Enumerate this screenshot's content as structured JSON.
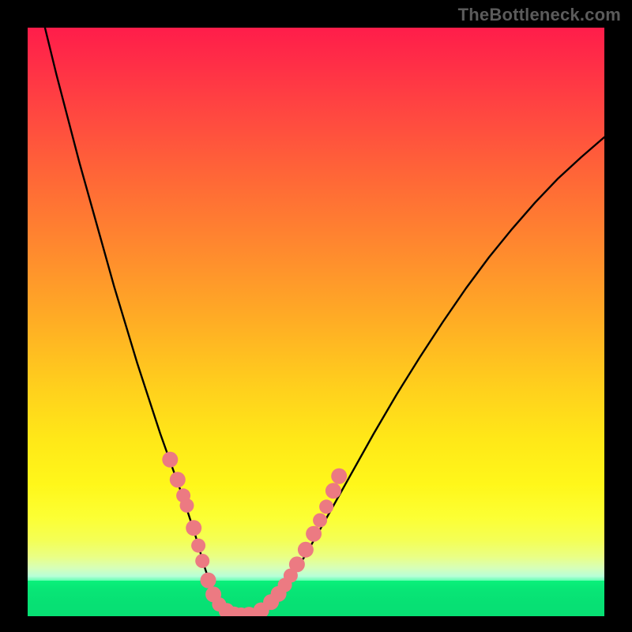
{
  "watermark": "TheBottleneck.com",
  "colors": {
    "frame": "#000000",
    "watermark_text": "#5b5b5b",
    "curve": "#000000",
    "dot": "#ec7a82",
    "gradient_top": "#ff1d4a",
    "gradient_bottom": "#07df73"
  },
  "chart_data": {
    "type": "line",
    "title": "",
    "xlabel": "",
    "ylabel": "",
    "xlim": [
      0,
      100
    ],
    "ylim": [
      0,
      100
    ],
    "grid": false,
    "legend": false,
    "annotations": [
      {
        "text": "TheBottleneck.com",
        "position": "top-right"
      }
    ],
    "series": [
      {
        "name": "bottleneck-curve",
        "type": "line",
        "x": [
          3,
          5,
          7,
          9,
          11,
          13,
          15,
          17,
          19,
          21,
          23,
          25,
          27,
          29,
          30.7,
          32.1,
          34,
          36,
          38,
          40,
          44,
          48,
          52,
          56,
          60,
          64,
          68,
          72,
          76,
          80,
          84,
          88,
          92,
          96,
          100
        ],
        "y": [
          100,
          92,
          84.5,
          77,
          70,
          63,
          56,
          49.5,
          43,
          37,
          31,
          25.5,
          20,
          14,
          8.3,
          4.2,
          1.6,
          0.4,
          0.1,
          0.7,
          4.3,
          10.1,
          17,
          24,
          31,
          37.7,
          44,
          50,
          55.7,
          61,
          65.8,
          70.3,
          74.4,
          78,
          81.4
        ]
      },
      {
        "name": "highlight-dots",
        "type": "scatter",
        "x": [
          24.7,
          26.0,
          27.0,
          27.6,
          28.8,
          29.6,
          30.3,
          31.3,
          32.2,
          33.2,
          34.5,
          35.8,
          37.0,
          38.4,
          40.5,
          42.2,
          43.5,
          44.6,
          45.6,
          46.7,
          48.2,
          49.6,
          50.7,
          51.8,
          53.0,
          54.0
        ],
        "y": [
          26.6,
          23.2,
          20.5,
          18.8,
          15.0,
          12.0,
          9.4,
          6.1,
          3.7,
          2.0,
          0.9,
          0.3,
          0.15,
          0.25,
          1.0,
          2.4,
          3.8,
          5.3,
          6.9,
          8.8,
          11.3,
          14.0,
          16.3,
          18.6,
          21.3,
          23.8
        ],
        "r": [
          10,
          10,
          9,
          9,
          10,
          9,
          9,
          10,
          10,
          9,
          10,
          10,
          10,
          10,
          10,
          10,
          10,
          9,
          9,
          10,
          10,
          10,
          9,
          9,
          10,
          10
        ]
      }
    ]
  }
}
